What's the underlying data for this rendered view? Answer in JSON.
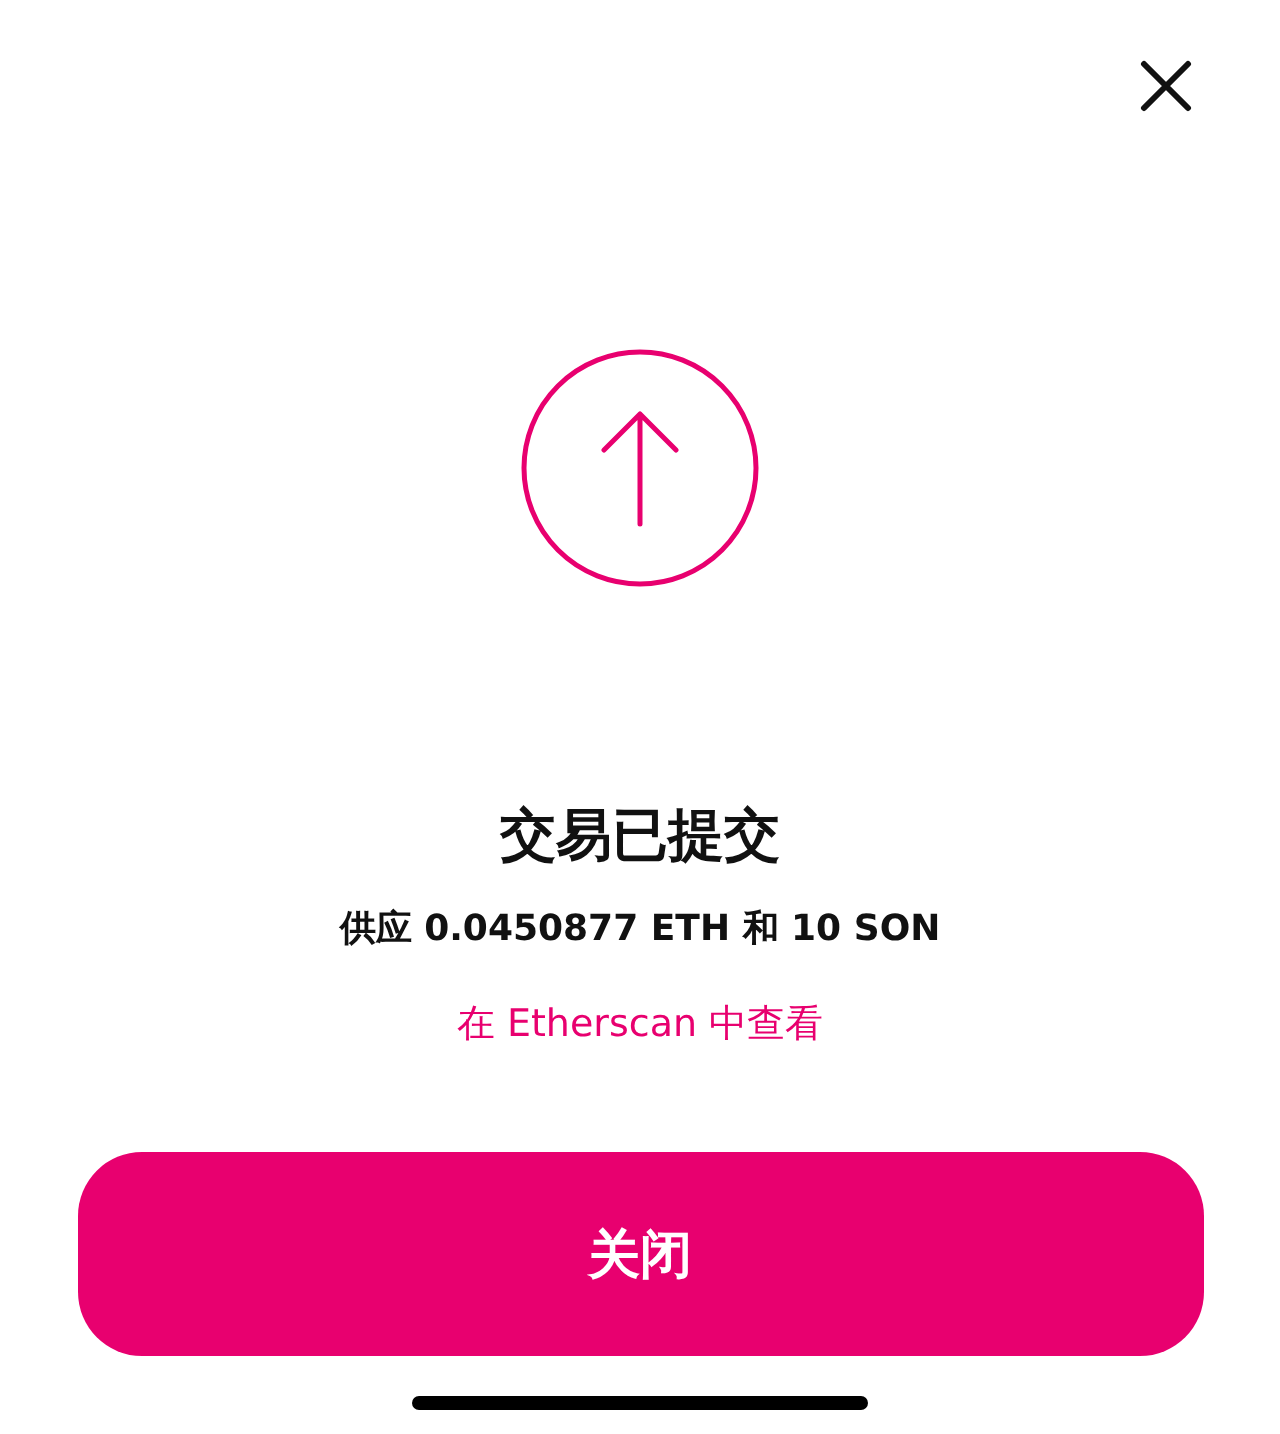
{
  "title": "交易已提交",
  "summary": "供应 0.0450877 ETH 和 10 SON",
  "link": "在 Etherscan 中查看",
  "button": "关闭"
}
